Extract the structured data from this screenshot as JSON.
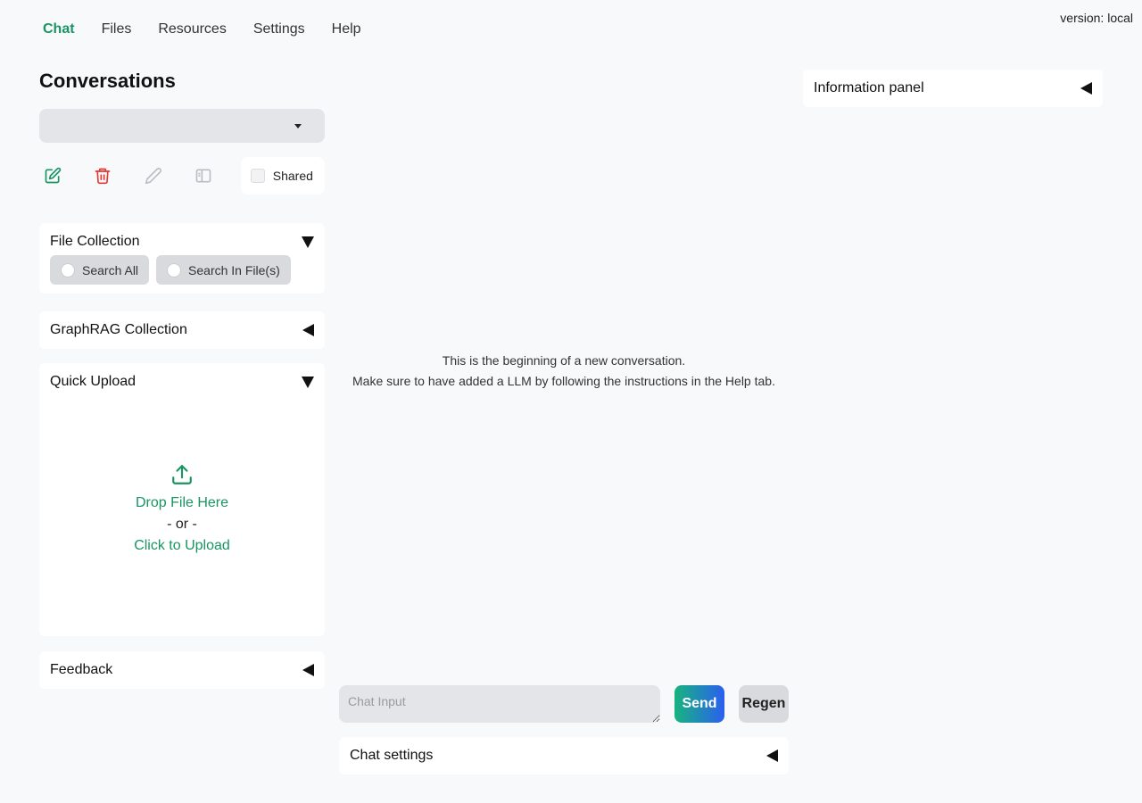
{
  "version": "version: local",
  "nav": {
    "tabs": [
      {
        "label": "Chat",
        "active": true
      },
      {
        "label": "Files"
      },
      {
        "label": "Resources"
      },
      {
        "label": "Settings"
      },
      {
        "label": "Help"
      }
    ]
  },
  "conversations": {
    "title": "Conversations",
    "selected": "",
    "shared_label": "Shared"
  },
  "file_collection": {
    "title": "File Collection",
    "options": [
      "Search All",
      "Search In File(s)"
    ]
  },
  "graphrag": {
    "title": "GraphRAG Collection"
  },
  "quick_upload": {
    "title": "Quick Upload",
    "drop": "Drop File Here",
    "or": "- or -",
    "click": "Click to Upload"
  },
  "feedback": {
    "title": "Feedback"
  },
  "chat": {
    "message_line1": "This is the beginning of a new conversation.",
    "message_line2": "Make sure to have added a LLM by following the instructions in the Help tab.",
    "input_placeholder": "Chat Input",
    "send_label": "Send",
    "regen_label": "Regen",
    "settings_title": "Chat settings"
  },
  "info_panel": {
    "title": "Information panel"
  },
  "colors": {
    "accent": "#1a9462",
    "danger": "#e53935",
    "background": "#f8f9fb"
  }
}
